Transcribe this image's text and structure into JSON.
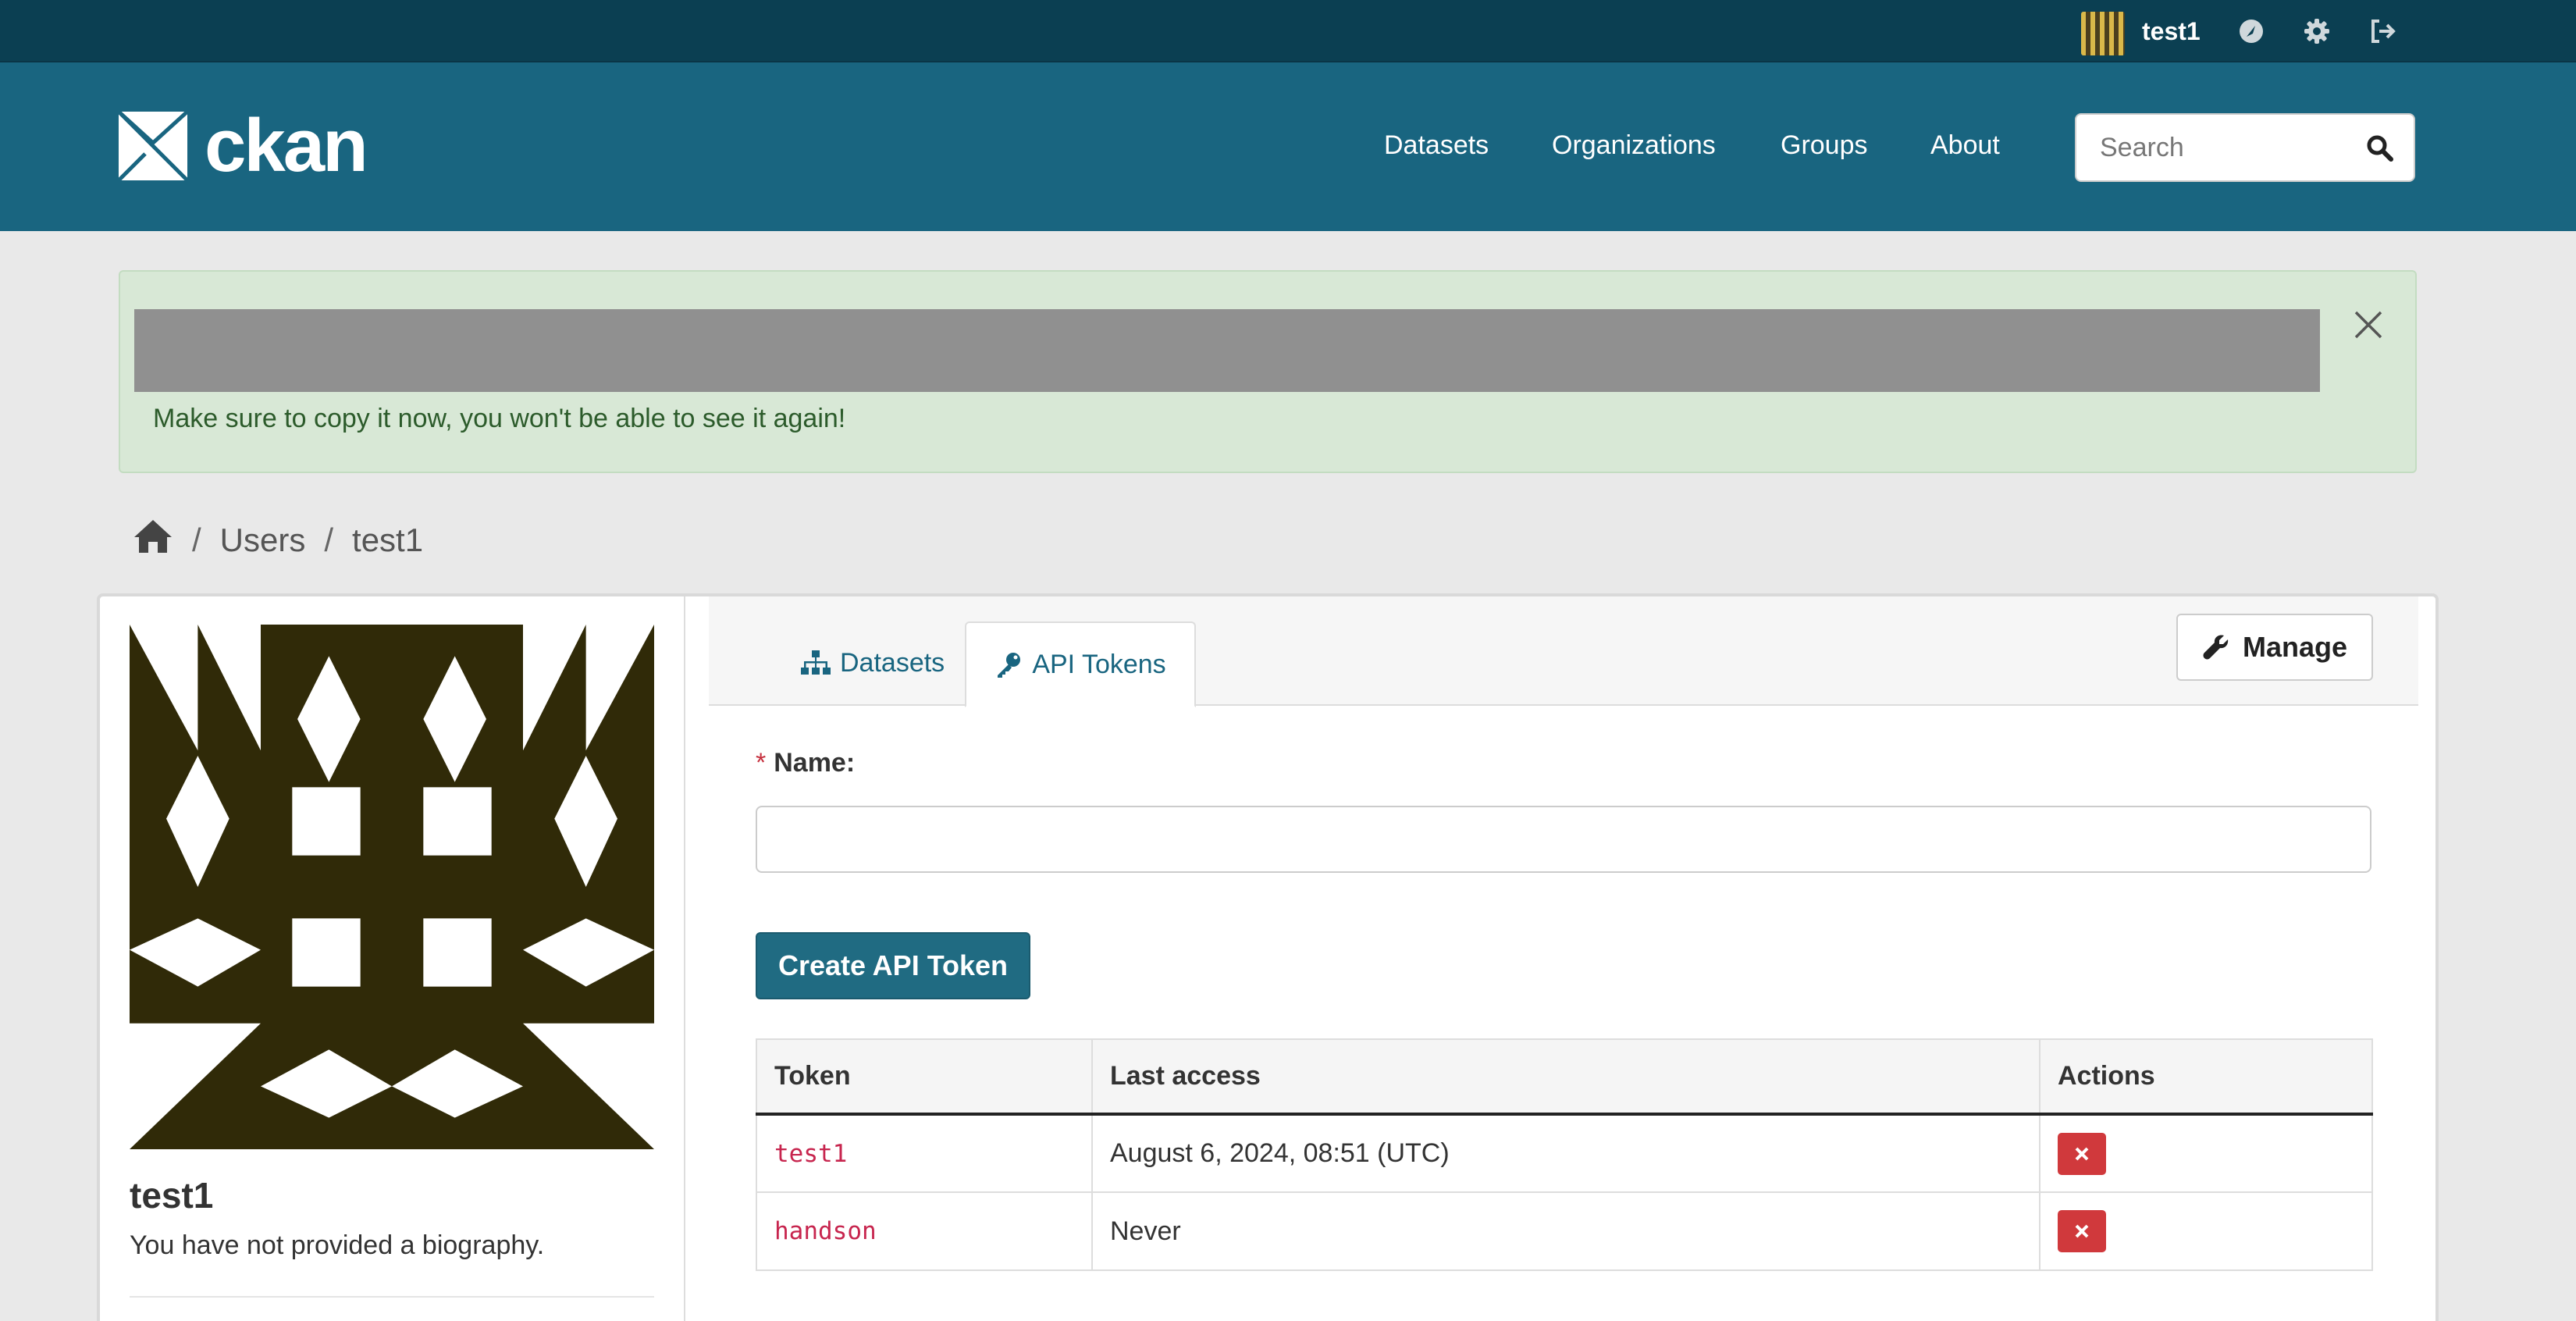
{
  "account": {
    "username": "test1",
    "icons": [
      "dashboard-icon",
      "settings-icon",
      "logout-icon"
    ]
  },
  "header": {
    "logo_text": "ckan",
    "nav": [
      "Datasets",
      "Organizations",
      "Groups",
      "About"
    ],
    "search_placeholder": "Search"
  },
  "alert": {
    "message": "Make sure to copy it now, you won't be able to see it again!"
  },
  "breadcrumb": {
    "items": [
      "Users",
      "test1"
    ]
  },
  "profile": {
    "name": "test1",
    "bio": "You have not provided a biography."
  },
  "tabs": {
    "datasets": "Datasets",
    "api_tokens": "API Tokens",
    "active": "API Tokens"
  },
  "manage_label": "Manage",
  "form": {
    "name_label": "Name:",
    "name_value": "",
    "submit_label": "Create API Token"
  },
  "tokens_table": {
    "headers": [
      "Token",
      "Last access",
      "Actions"
    ],
    "rows": [
      {
        "token": "test1",
        "last_access": "August 6, 2024, 08:51 (UTC)"
      },
      {
        "token": "handson",
        "last_access": "Never"
      }
    ]
  },
  "colors": {
    "masthead": "#196580",
    "account_bar": "#0b3f52",
    "alert_bg": "#d8e8d6",
    "primary_button": "#206b82",
    "danger": "#d0393c",
    "token_text": "#c7254e",
    "avatar_fg": "#302a08"
  }
}
